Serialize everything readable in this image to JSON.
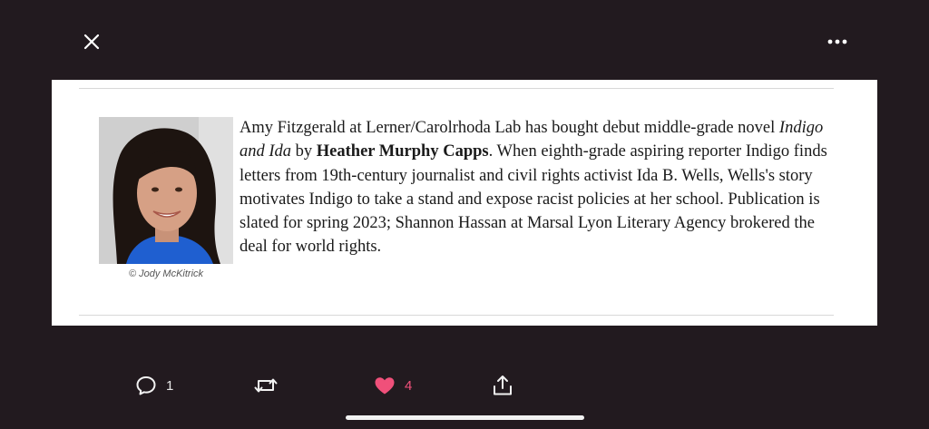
{
  "toolbar": {
    "close_icon": "close-icon",
    "more_icon": "more-horizontal-icon"
  },
  "article": {
    "credit": "© Jody McKitrick",
    "text_1": "Amy Fitzgerald at Lerner/Carolrhoda Lab has bought debut middle-grade novel ",
    "book_title": "Indigo and Ida",
    "text_2": " by ",
    "author": "Heather Murphy Capps",
    "text_3": ". When eighth-grade aspiring reporter Indigo finds letters from 19th-century journalist and civil rights activist Ida B. Wells, Wells's story motivates Indigo to take a stand and expose racist policies at her school. Publication is slated for spring 2023; Shannon Hassan at Marsal Lyon Literary Agency brokered the deal for world rights."
  },
  "actions": {
    "reply_count": "1",
    "like_count": "4"
  },
  "colors": {
    "background": "#221a1f",
    "like_accent": "#f0507a"
  }
}
